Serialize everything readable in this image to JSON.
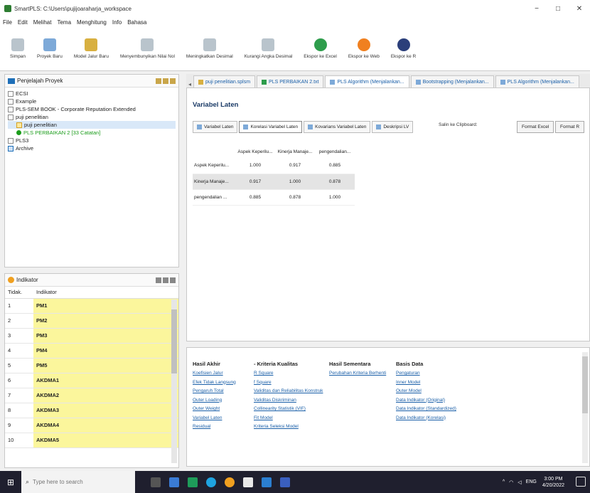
{
  "window": {
    "title": "SmartPLS: C:\\Users\\pujijoaraharja_workspace",
    "controls": [
      "−",
      "□",
      "✕"
    ]
  },
  "menu": [
    "File",
    "Edit",
    "Melihat",
    "Tema",
    "Menghitung",
    "Info",
    "Bahasa"
  ],
  "toolbar": [
    {
      "label": "Simpan",
      "icon": "save-icon",
      "color": "grey"
    },
    {
      "label": "Proyek Baru",
      "icon": "new-project-icon",
      "color": "grey"
    },
    {
      "label": "Model Jalur Baru",
      "icon": "new-path-model-icon",
      "color": "yellow"
    },
    {
      "label": "Menyembunyikan Nilai Nol",
      "icon": "hide-zero-icon",
      "color": "grey"
    },
    {
      "label": "Meningkatkan Desimal",
      "icon": "increase-decimal-icon",
      "color": "grey"
    },
    {
      "label": "Kurangi Angka Desimal",
      "icon": "decrease-decimal-icon",
      "color": "grey"
    },
    {
      "label": "Ekspor ke Excel",
      "icon": "excel-icon",
      "color": "green"
    },
    {
      "label": "Ekspor ke Web",
      "icon": "web-icon",
      "color": "orange"
    },
    {
      "label": "Ekspor ke R",
      "icon": "r-icon",
      "color": "navy"
    }
  ],
  "project_pane": {
    "title": "Penjelajah Proyek",
    "tree": [
      {
        "label": "ECSI",
        "level": 0,
        "type": "folder"
      },
      {
        "label": "Example",
        "level": 0,
        "type": "folder"
      },
      {
        "label": "PLS-SEM BOOK - Corporate Reputation Extended",
        "level": 0,
        "type": "folder"
      },
      {
        "label": "puji penelitian",
        "level": 0,
        "type": "folder"
      },
      {
        "label": "puji penelitian",
        "level": 1,
        "type": "model",
        "selected": true
      },
      {
        "label": "PLS PERBAIKAN 2 [33 Catatan]",
        "level": 1,
        "type": "data"
      },
      {
        "label": "PLS3",
        "level": 0,
        "type": "folder"
      },
      {
        "label": "Archive",
        "level": 0,
        "type": "archive"
      }
    ]
  },
  "indicator_pane": {
    "title": "Indikator",
    "headers": [
      "Tidak.",
      "Indikator"
    ],
    "rows": [
      {
        "no": "1",
        "name": "PM1"
      },
      {
        "no": "2",
        "name": "PM2"
      },
      {
        "no": "3",
        "name": "PM3"
      },
      {
        "no": "4",
        "name": "PM4"
      },
      {
        "no": "5",
        "name": "PM5"
      },
      {
        "no": "6",
        "name": "AKDMA1"
      },
      {
        "no": "7",
        "name": "AKDMA2"
      },
      {
        "no": "8",
        "name": "AKDMA3"
      },
      {
        "no": "9",
        "name": "AKDMA4"
      },
      {
        "no": "10",
        "name": "AKDMA5"
      }
    ]
  },
  "editor_tabs": [
    {
      "label": "puji penelitian.splsm",
      "active": false
    },
    {
      "label": "PLS PERBAIKAN 2.txt",
      "active": false
    },
    {
      "label": "PLS Algorithm (Menjalankan...",
      "active": true
    },
    {
      "label": "Bootstrapping (Menjalankan...",
      "active": false
    },
    {
      "label": "PLS Algorithm (Menjalankan...",
      "active": false
    }
  ],
  "editor": {
    "title": "Variabel Laten",
    "subtabs": [
      {
        "label": "Variabel Laten",
        "active": false
      },
      {
        "label": "Korelasi Variabel Laten",
        "active": true
      },
      {
        "label": "Kovarians Variabel Laten",
        "active": false
      },
      {
        "label": "Deskripsi LV",
        "active": false
      }
    ],
    "copy_label": "Salin ke Clipboard:",
    "format_excel": "Format Excel",
    "format_r": "Format R",
    "table": {
      "columns": [
        "Aspek Keperilu...",
        "Kinerja Manaje...",
        "pengendalian..."
      ],
      "rows": [
        {
          "label": "Aspek Keperilu...",
          "values": [
            "1.000",
            "0.917",
            "0.885"
          ],
          "highlight": false
        },
        {
          "label": "Kinerja Manaje...",
          "values": [
            "0.917",
            "1.000",
            "0.878"
          ],
          "highlight": true
        },
        {
          "label": "pengendalian ...",
          "values": [
            "0.885",
            "0.878",
            "1.000"
          ],
          "highlight": false
        }
      ]
    }
  },
  "bottom": {
    "columns": [
      {
        "header": "Hasil Akhir",
        "links": [
          "Koefisien Jalur",
          "Efek Tidak Langsung",
          "Pengaruh Total",
          "Outer Loading",
          "Outer Weight",
          "Variabel Laten",
          "Residual"
        ]
      },
      {
        "header": "- Kriteria Kualitas",
        "links": [
          "R Square",
          "f Square",
          "Validitas dan Reliabilitas Konstruk",
          "Validitas Diskriminan",
          "Collinearity Statistik (VIF)",
          "Fit Model",
          "Kriteria Seleksi Model"
        ]
      },
      {
        "header": "Hasil Sementara",
        "links": [
          "Perubahan Kriteria Berhenti"
        ]
      },
      {
        "header": "Basis Data",
        "links": [
          "Pengaturan",
          "Inner Model",
          "Outer Model",
          "Data Indikator (Original)",
          "Data Indikator (Standardized)",
          "Data Indikator (Korelasi)"
        ]
      }
    ]
  },
  "taskbar": {
    "search_placeholder": "Type here to search",
    "time": "3:00 PM",
    "date": "4/20/2022",
    "lang": "ENG"
  }
}
